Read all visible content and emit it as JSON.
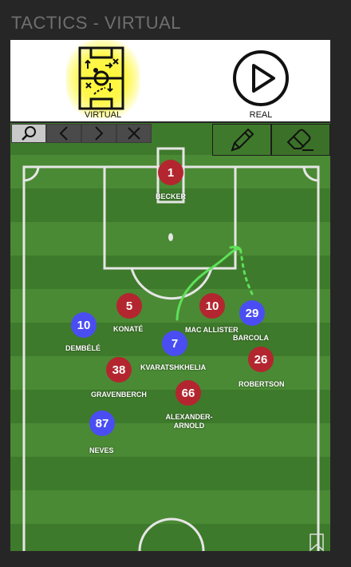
{
  "header": {
    "title": "TACTICS - VIRTUAL"
  },
  "modes": {
    "virtual": {
      "label": "VIRTUAL"
    },
    "real": {
      "label": "REAL"
    }
  },
  "toolbar": {
    "search": "search-icon",
    "prev": "chevron-left-icon",
    "next": "chevron-right-icon",
    "clear": "close-icon",
    "draw": "pencil-icon",
    "erase": "eraser-icon"
  },
  "colors": {
    "virtual_highlight": "#fff730",
    "red_team": "#b3262f",
    "blue_team": "#4a4ef2",
    "draw_active": "#3f7a2c",
    "drawing_stroke": "#5ee05a"
  },
  "players": [
    {
      "number": "1",
      "name": "BECKER",
      "team": "red"
    },
    {
      "number": "5",
      "name": "KONATÉ",
      "team": "red"
    },
    {
      "number": "10",
      "name": "MAC ALLISTER",
      "team": "red"
    },
    {
      "number": "29",
      "name": "BARCOLA",
      "team": "blue"
    },
    {
      "number": "10",
      "name": "DEMBÉLÉ",
      "team": "blue"
    },
    {
      "number": "7",
      "name": "KVARATSHKHELIA",
      "team": "blue"
    },
    {
      "number": "38",
      "name": "GRAVENBERCH",
      "team": "red"
    },
    {
      "number": "26",
      "name": "ROBERTSON",
      "team": "red"
    },
    {
      "number": "66",
      "name": "ALEXANDER-ARNOLD",
      "team": "red"
    },
    {
      "number": "87",
      "name": "NEVES",
      "team": "blue"
    }
  ]
}
